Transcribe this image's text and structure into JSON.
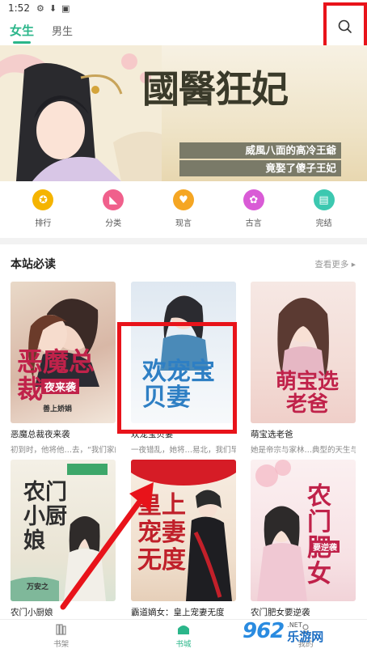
{
  "status_bar": {
    "time": "1:52"
  },
  "top_tabs": [
    {
      "label": "女生",
      "active": true
    },
    {
      "label": "男生",
      "active": false
    }
  ],
  "banner": {
    "title": "國醫狂妃",
    "subtitle_line1": "威風八面的高冷王爺",
    "subtitle_line2": "竟娶了傻子王妃"
  },
  "categories": [
    {
      "label": "排行",
      "icon": "medal-icon",
      "color": "#f5b400"
    },
    {
      "label": "分类",
      "icon": "heel-icon",
      "color": "#f0608c"
    },
    {
      "label": "现言",
      "icon": "heart-icon",
      "color": "#f5a623"
    },
    {
      "label": "古言",
      "icon": "fan-icon",
      "color": "#d95bd6"
    },
    {
      "label": "完结",
      "icon": "book-icon",
      "color": "#3cc8b0"
    }
  ],
  "section": {
    "title": "本站必读",
    "more": "查看更多"
  },
  "books": [
    {
      "title": "恶魔总裁夜来袭",
      "desc": "初到时，他将他…去，“我们家的",
      "cover_text": "恶魔总裁",
      "cover_sub": "夜来袭",
      "author_tag": "善上娇娟"
    },
    {
      "title": "欢宠宝贝妻",
      "desc": "一夜错乱，她将…易北，我们早协",
      "cover_text": "欢宠宝贝妻",
      "cover_sub": "",
      "author_tag": ""
    },
    {
      "title": "萌宝选老爸",
      "desc": "她是帝宗与家林…典型的天生与白",
      "cover_text": "萌宝选老爸",
      "cover_sub": "",
      "author_tag": ""
    },
    {
      "title": "农门小厨娘",
      "desc": "",
      "cover_text": "农门小厨娘",
      "cover_sub": "万安之",
      "author_tag": ""
    },
    {
      "title": "霸道嫡女：皇上宠妻无度",
      "desc": "",
      "cover_text": "皇上宠妻无度",
      "cover_sub": "",
      "author_tag": ""
    },
    {
      "title": "农门肥女要逆袭",
      "desc": "",
      "cover_text": "农门肥女",
      "cover_sub": "要逆袭",
      "author_tag": ""
    }
  ],
  "bottom_nav": [
    {
      "label": "书架",
      "active": false
    },
    {
      "label": "书城",
      "active": true
    },
    {
      "label": "我的",
      "active": false
    }
  ],
  "watermark": {
    "logo": "962",
    "net": ".NET",
    "name": "乐游网"
  },
  "colors": {
    "accent": "#2bb68a",
    "highlight": "#e8131a"
  }
}
